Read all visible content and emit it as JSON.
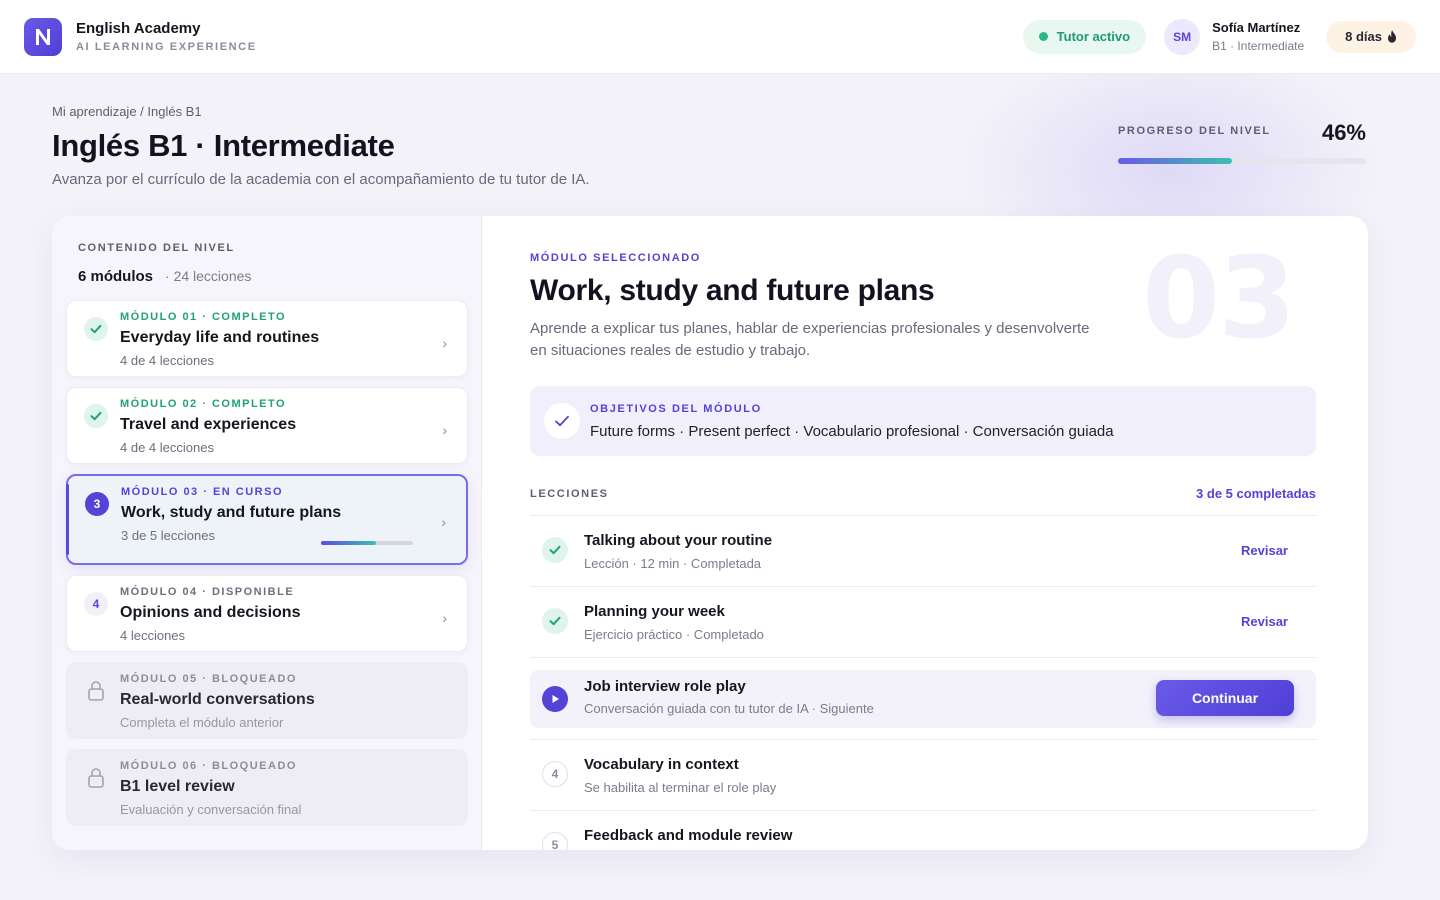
{
  "app": {
    "logo_letter": "N",
    "name": "English Academy",
    "tagline": "AI LEARNING EXPERIENCE"
  },
  "topbar": {
    "tutor_status": "Tutor activo",
    "avatar_initials": "SM",
    "user_name": "Sofía Martínez",
    "user_level": "B1 · Intermediate",
    "streak_label": "8 días",
    "streak_icon": "flame-icon"
  },
  "header": {
    "breadcrumb": "Mi aprendizaje / Inglés B1",
    "title": "Inglés B1 · Intermediate",
    "subtitle": "Avanza por el currículo de la academia con el acompañamiento de tu tutor de IA.",
    "progress_label": "PROGRESO DEL NIVEL",
    "progress_value": "46%",
    "progress_fraction": 0.46
  },
  "sidebar": {
    "label": "CONTENIDO DEL NIVEL",
    "modules_count": "6 módulos",
    "lessons_count": "· 24 lecciones",
    "modules": [
      {
        "badge": "",
        "tag": "MÓDULO 01 · COMPLETO",
        "title": "Everyday life and routines",
        "sub": "4 de 4 lecciones",
        "state": "done"
      },
      {
        "badge": "",
        "tag": "MÓDULO 02 · COMPLETO",
        "title": "Travel and experiences",
        "sub": "4 de 4 lecciones",
        "state": "done"
      },
      {
        "badge": "3",
        "tag": "MÓDULO 03 · EN CURSO",
        "title": "Work, study and future plans",
        "sub": "3 de 5 lecciones",
        "state": "current",
        "progress_fraction": 0.6
      },
      {
        "badge": "4",
        "tag": "MÓDULO 04 · DISPONIBLE",
        "title": "Opinions and decisions",
        "sub": "4 lecciones",
        "state": "available"
      },
      {
        "badge": "",
        "tag": "MÓDULO 05 · BLOQUEADO",
        "title": "Real-world conversations",
        "sub": "Completa el módulo anterior",
        "state": "locked"
      },
      {
        "badge": "",
        "tag": "MÓDULO 06 · BLOQUEADO",
        "title": "B1 level review",
        "sub": "Evaluación y conversación final",
        "state": "locked"
      }
    ],
    "chevron": "›"
  },
  "detail": {
    "big_number": "03",
    "label": "MÓDULO SELECCIONADO",
    "title": "Work, study and future plans",
    "description": "Aprende a explicar tus planes, hablar de experiencias profesionales y desenvolverte en situaciones reales de estudio y trabajo.",
    "objectives_label": "OBJETIVOS DEL MÓDULO",
    "objectives": "Future forms · Present perfect · Vocabulario profesional · Conversación guiada",
    "lessons_label": "LECCIONES",
    "lessons_completed": "3 de 5 completadas",
    "lessons": [
      {
        "num": "",
        "title": "Talking about your routine",
        "sub": "Lección · 12 min · Completada",
        "action": "Revisar",
        "state": "done"
      },
      {
        "num": "",
        "title": "Planning your week",
        "sub": "Ejercicio práctico · Completado",
        "action": "Revisar",
        "state": "done"
      },
      {
        "num": "",
        "title": "Job interview role play",
        "sub": "Conversación guiada con tu tutor de IA · Siguiente",
        "action": "Continuar",
        "state": "active"
      },
      {
        "num": "4",
        "title": "Vocabulary in context",
        "sub": "Se habilita al terminar el role play",
        "action": "",
        "state": "pending"
      },
      {
        "num": "5",
        "title": "Feedback and module review",
        "sub": "",
        "action": "",
        "state": "pending"
      }
    ]
  },
  "colors": {
    "accent": "#5343d6",
    "success": "#21a07a",
    "progress_end": "#3ec0b0",
    "background": "#f3f2f9"
  }
}
